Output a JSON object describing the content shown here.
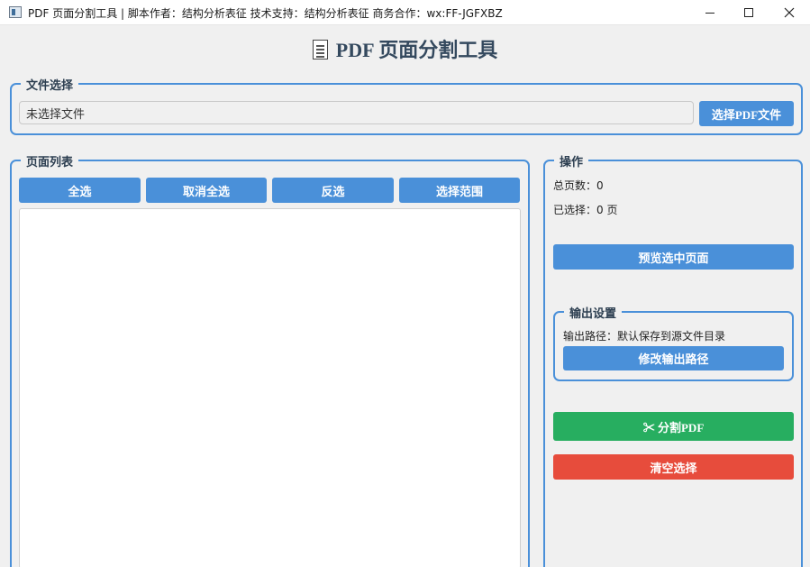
{
  "window": {
    "title": "PDF 页面分割工具 | 脚本作者：结构分析表征 技术支持：结构分析表征 商务合作：wx:FF-JGFXBZ",
    "minimize_label": "—",
    "maximize_label": "☐",
    "close_label": "✕"
  },
  "heading": "PDF 页面分割工具",
  "file_section": {
    "title": "文件选择",
    "file_value": "未选择文件",
    "select_button": "选择PDF文件"
  },
  "page_list_section": {
    "title": "页面列表",
    "buttons": [
      "全选",
      "取消全选",
      "反选",
      "选择范围"
    ],
    "items": []
  },
  "operations": {
    "title": "操作",
    "total_pages": "总页数：0",
    "selected": "已选择：0 页",
    "preview_button": "预览选中页面",
    "output": {
      "title": "输出设置",
      "path_label": "输出路径：默认保存到源文件目录",
      "change_button": "修改输出路径"
    },
    "split_button": "✂ 分割PDF",
    "clear_button": "清空选择"
  },
  "colors": {
    "accent": "#4a90d9",
    "success": "#27ae60",
    "danger": "#e74c3c",
    "heading": "#34495e"
  }
}
